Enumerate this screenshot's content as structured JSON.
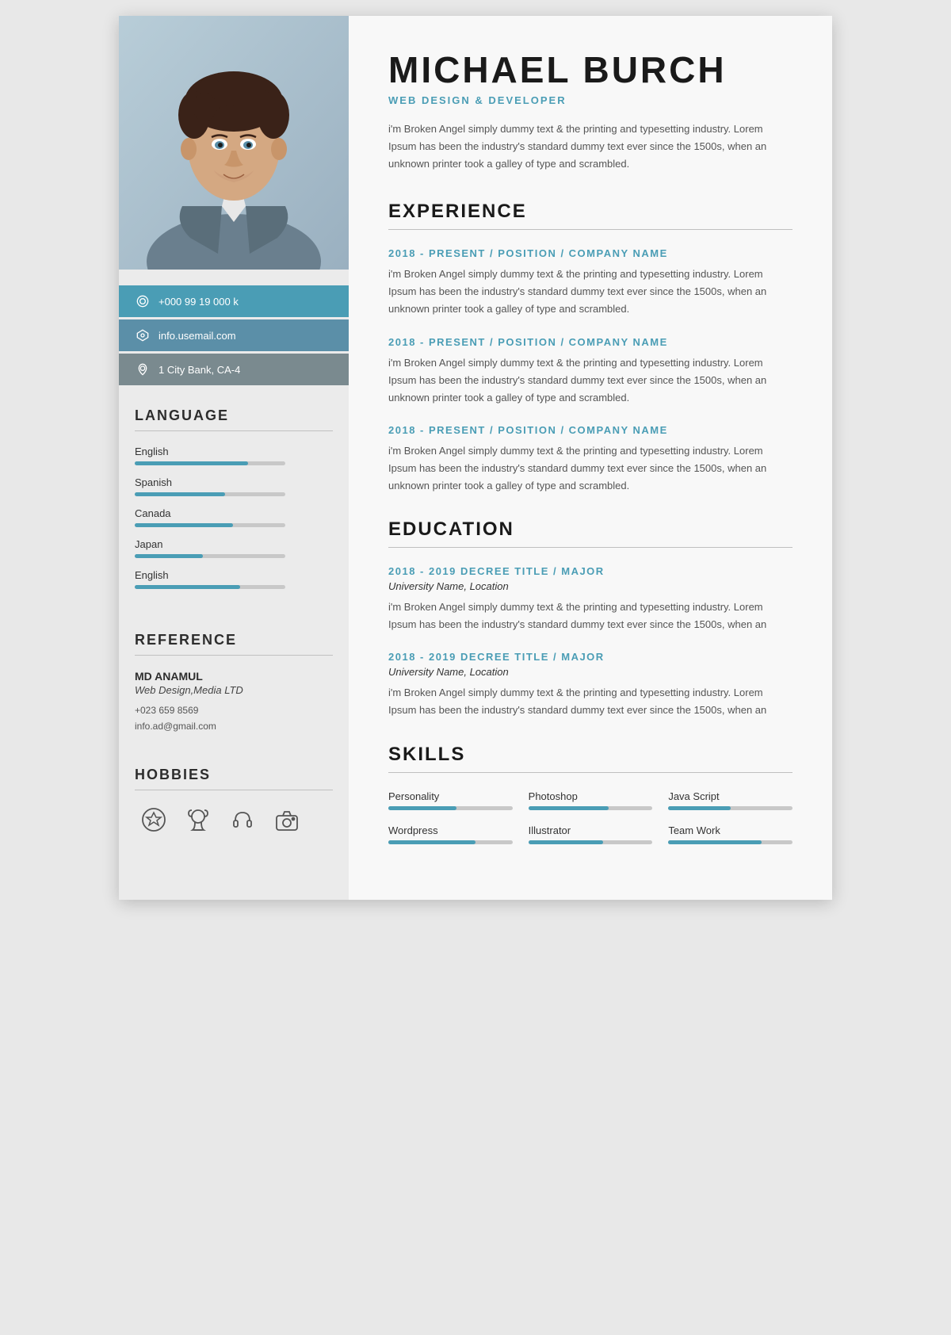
{
  "profile": {
    "name": "MICHAEL BURCH",
    "job_title": "WEB DESIGN & DEVELOPER",
    "summary": "i'm Broken Angel simply dummy text & the printing and typesetting industry. Lorem Ipsum has been the industry's standard dummy text ever since the 1500s, when an unknown printer took a galley of type and scrambled."
  },
  "contact": {
    "phone": "+000 99 19 000 k",
    "email": "info.usemail.com",
    "address": "1 City Bank, CA-4"
  },
  "language": {
    "section_title": "LANGUAGE",
    "items": [
      {
        "name": "English",
        "percent": 75
      },
      {
        "name": "Spanish",
        "percent": 60
      },
      {
        "name": "Canada",
        "percent": 65
      },
      {
        "name": "Japan",
        "percent": 45
      },
      {
        "name": "English",
        "percent": 70
      }
    ]
  },
  "reference": {
    "section_title": "REFERENCE",
    "name": "MD ANAMUL",
    "company": "Web Design,Media LTD",
    "phone": "+023 659 8569",
    "email": "info.ad@gmail.com"
  },
  "hobbies": {
    "section_title": "HOBBIES"
  },
  "experience": {
    "section_title": "EXPERIENCE",
    "items": [
      {
        "period_position": "2018 - PRESENT / POSITION / COMPANY NAME",
        "text": "i'm Broken Angel simply dummy text & the printing and typesetting industry. Lorem Ipsum has been the industry's standard dummy text ever since the 1500s, when an unknown printer took a galley of type and scrambled."
      },
      {
        "period_position": "2018 - PRESENT / POSITION / COMPANY NAME",
        "text": "i'm Broken Angel simply dummy text & the printing and typesetting industry. Lorem Ipsum has been the industry's standard dummy text ever since the 1500s, when an unknown printer took a galley of type and scrambled."
      },
      {
        "period_position": "2018 - PRESENT / POSITION / COMPANY NAME",
        "text": "i'm Broken Angel simply dummy text & the printing and typesetting industry. Lorem Ipsum has been the industry's standard dummy text ever since the 1500s, when an unknown printer took a galley of type and scrambled."
      }
    ]
  },
  "education": {
    "section_title": "EDUCATION",
    "items": [
      {
        "degree": "2018 - 2019 DECREE TITLE / MAJOR",
        "university": "University Name, Location",
        "text": "i'm Broken Angel simply dummy text & the printing and typesetting industry. Lorem Ipsum has been the industry's standard dummy text ever since the 1500s, when an"
      },
      {
        "degree": "2018 - 2019 DECREE TITLE / MAJOR",
        "university": "University Name, Location",
        "text": "i'm Broken Angel simply dummy text & the printing and typesetting industry. Lorem Ipsum has been the industry's standard dummy text ever since the 1500s, when an"
      }
    ]
  },
  "skills": {
    "section_title": "SKILLS",
    "items": [
      {
        "name": "Personality",
        "percent": 55
      },
      {
        "name": "Photoshop",
        "percent": 65
      },
      {
        "name": "Java Script",
        "percent": 50
      },
      {
        "name": "Wordpress",
        "percent": 70
      },
      {
        "name": "Illustrator",
        "percent": 60
      },
      {
        "name": "Team Work",
        "percent": 75
      }
    ]
  }
}
